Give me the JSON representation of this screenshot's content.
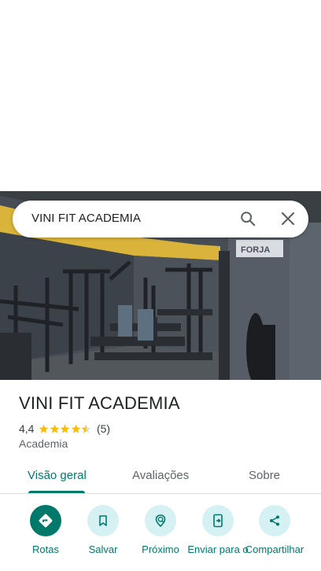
{
  "search": {
    "query": "VINI FIT ACADEMIA"
  },
  "place": {
    "title": "VINI FIT ACADEMIA",
    "rating": "4,4",
    "stars": 4.4,
    "review_count": "(5)",
    "category": "Academia"
  },
  "tabs": [
    {
      "label": "Visão geral",
      "active": true
    },
    {
      "label": "Avaliações",
      "active": false
    },
    {
      "label": "Sobre",
      "active": false
    }
  ],
  "actions": [
    {
      "label": "Rotas",
      "icon": "directions-icon"
    },
    {
      "label": "Salvar",
      "icon": "bookmark-icon"
    },
    {
      "label": "Próximo",
      "icon": "nearby-icon"
    },
    {
      "label": "Enviar para o",
      "icon": "send-to-phone-icon"
    },
    {
      "label": "Compartilhar",
      "icon": "share-icon"
    }
  ],
  "photo": {
    "sign_text": "FORJA"
  },
  "colors": {
    "accent": "#00796b",
    "action_bg": "#d6f1f4",
    "star": "#fbbc04"
  }
}
